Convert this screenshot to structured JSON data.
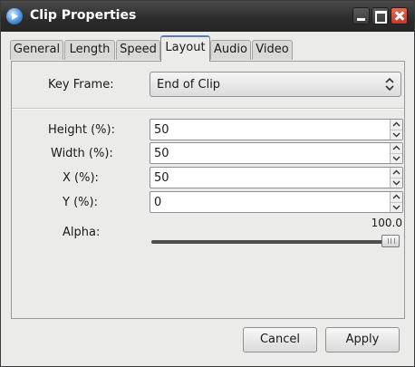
{
  "window": {
    "title": "Clip Properties"
  },
  "tabs": [
    {
      "label": "General"
    },
    {
      "label": "Length"
    },
    {
      "label": "Speed"
    },
    {
      "label": "Layout",
      "active": true
    },
    {
      "label": "Audio"
    },
    {
      "label": "Video"
    }
  ],
  "layout": {
    "key_frame_label": "Key Frame:",
    "key_frame_value": "End of Clip",
    "height_label": "Height (%):",
    "height_value": "50",
    "width_label": "Width (%):",
    "width_value": "50",
    "x_label": "X (%):",
    "x_value": "50",
    "y_label": "Y (%):",
    "y_value": "0",
    "alpha_label": "Alpha:",
    "alpha_value": "100.0",
    "alpha_fraction": 1.0
  },
  "buttons": {
    "cancel": "Cancel",
    "apply": "Apply"
  },
  "colors": {
    "titlebar": "#2b2b2b",
    "close_button": "#d0482f",
    "active_tab_accent": "#5b7fb5"
  }
}
